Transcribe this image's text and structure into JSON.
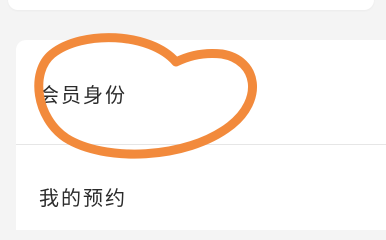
{
  "menu": {
    "items": [
      {
        "label": "会员身份"
      },
      {
        "label": "我的预约"
      }
    ]
  },
  "colors": {
    "annotation_circle": "#f28a3c",
    "card_background": "#ffffff",
    "page_background": "#f4f4f4",
    "text": "#2b2b2b"
  }
}
